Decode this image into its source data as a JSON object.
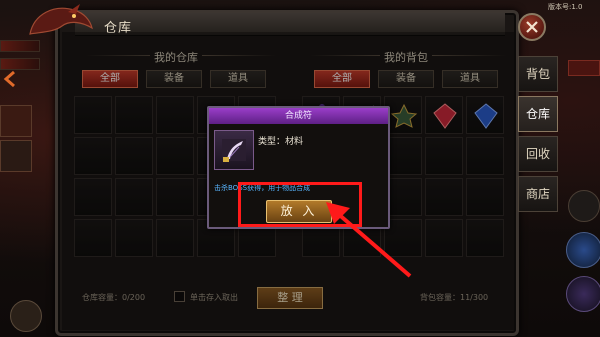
{
  "window": {
    "title": "仓库"
  },
  "top_right_text": "版本号:1.0",
  "warehouse": {
    "title": "我的仓库",
    "filters": [
      {
        "label": "全部",
        "active": true
      },
      {
        "label": "装备",
        "active": false
      },
      {
        "label": "道具",
        "active": false
      }
    ],
    "capacity_text": "仓库容量：0/200",
    "quick_store_label": "单击存入取出"
  },
  "backpack": {
    "title": "我的背包",
    "filters": [
      {
        "label": "全部",
        "active": true
      },
      {
        "label": "装备",
        "active": false
      },
      {
        "label": "道具",
        "active": false
      }
    ],
    "capacity_text": "背包容量：11/300",
    "items": [
      "ring-icon",
      "sword-icon",
      "amulet-icon",
      "gem-red-icon",
      "gem-blue-icon",
      "bracelet-icon"
    ]
  },
  "sort_button": "整 理",
  "side_tabs": [
    {
      "label": "背包",
      "active": false
    },
    {
      "label": "仓库",
      "active": true
    },
    {
      "label": "回收",
      "active": false
    },
    {
      "label": "商店",
      "active": false
    }
  ],
  "tooltip": {
    "title": "合成符",
    "type_text": "类型：材料",
    "description": "击杀BOSS获得，用于物品合成",
    "item_icon": "scroll-icon",
    "action_button": "放 入"
  },
  "colors": {
    "accent_red": "#c23a2a",
    "tooltip_header": "#7a2ea8",
    "description_blue": "#59b6ff",
    "highlight": "#ff1a1a"
  }
}
